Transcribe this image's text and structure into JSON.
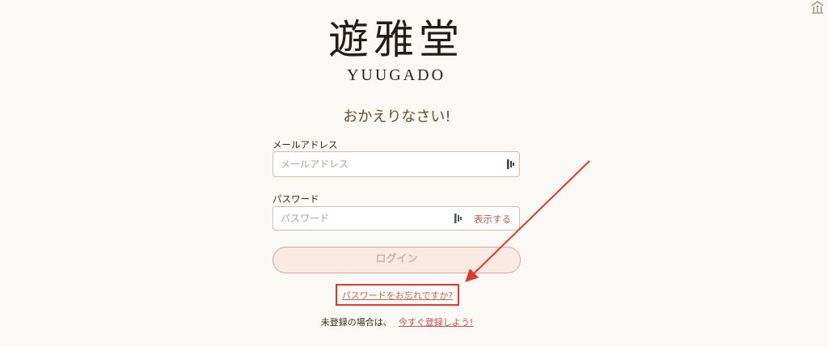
{
  "brand": {
    "logo_kanji": "遊雅堂",
    "logo_roman": "YUUGADO"
  },
  "welcome": "おかえりなさい!",
  "email": {
    "label": "メールアドレス",
    "placeholder": "メールアドレス",
    "value": ""
  },
  "password": {
    "label": "パスワード",
    "placeholder": "パスワード",
    "value": "",
    "show_label": "表示する"
  },
  "login_button": "ログイン",
  "forgot_password": "パスワードをお忘れですか?",
  "register": {
    "prompt": "未登録の場合は、",
    "link": "今すぐ登録しよう!"
  },
  "icons": {
    "corner": "accessibility-icon",
    "password_manager": "password-manager-icon"
  },
  "colors": {
    "accent": "#c4534b",
    "annotation": "#e0392c",
    "background": "#fbf9f5",
    "button_fill": "#fbe9e3"
  }
}
